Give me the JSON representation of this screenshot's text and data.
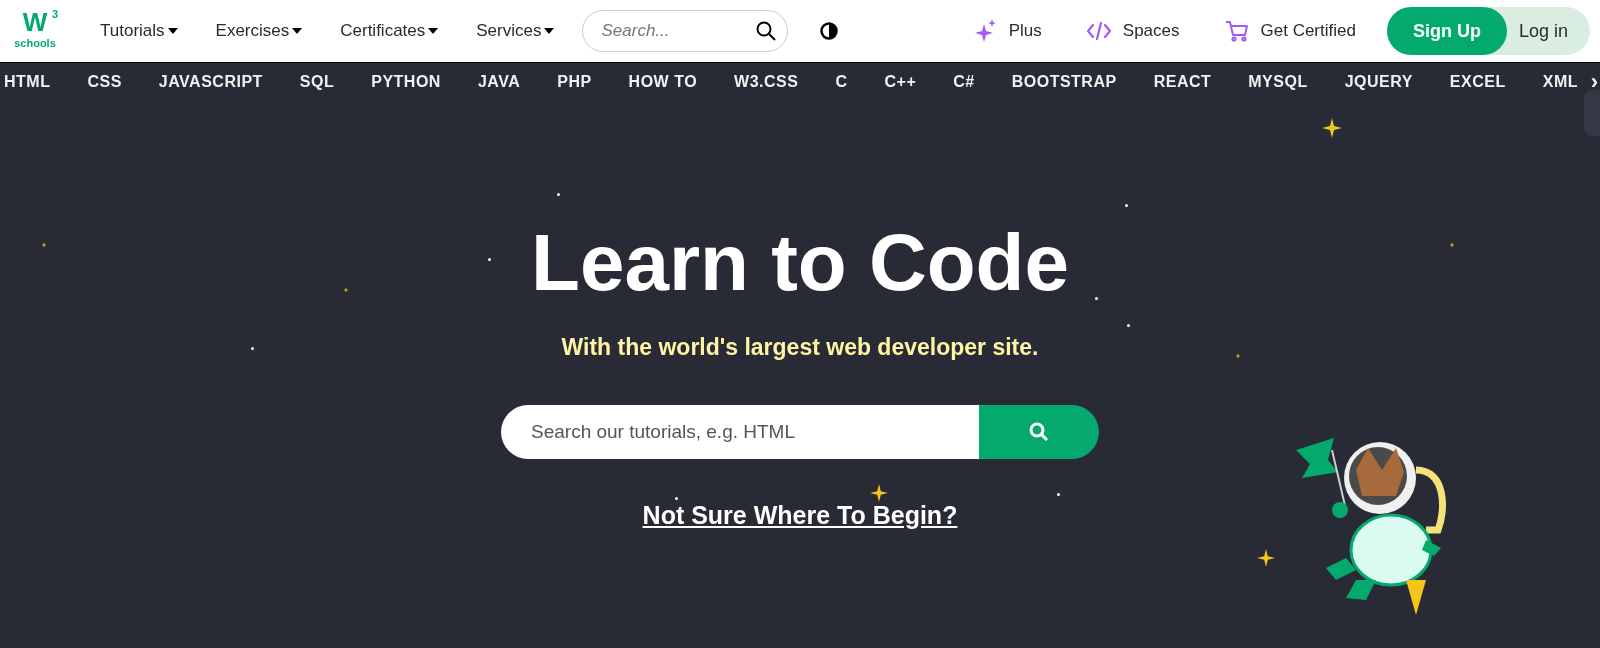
{
  "logo": {
    "mark": "W",
    "superscript": "3",
    "word": "schools"
  },
  "menu": [
    {
      "label": "Tutorials"
    },
    {
      "label": "Exercises"
    },
    {
      "label": "Certificates"
    },
    {
      "label": "Services"
    }
  ],
  "search": {
    "placeholder": "Search..."
  },
  "links": [
    {
      "kind": "plus",
      "label": "Plus"
    },
    {
      "kind": "spaces",
      "label": "Spaces"
    },
    {
      "kind": "cart",
      "label": "Get Certified"
    }
  ],
  "auth": {
    "signup": "Sign Up",
    "login": "Log in"
  },
  "topics": [
    "HTML",
    "CSS",
    "JAVASCRIPT",
    "SQL",
    "PYTHON",
    "JAVA",
    "PHP",
    "HOW TO",
    "W3.CSS",
    "C",
    "C++",
    "C#",
    "BOOTSTRAP",
    "REACT",
    "MYSQL",
    "JQUERY",
    "EXCEL",
    "XML"
  ],
  "topics_more": "›",
  "hero": {
    "title": "Learn to Code",
    "subtitle": "With the world's largest web developer site.",
    "search_placeholder": "Search our tutorials, e.g. HTML",
    "link": "Not Sure Where To Begin?"
  }
}
